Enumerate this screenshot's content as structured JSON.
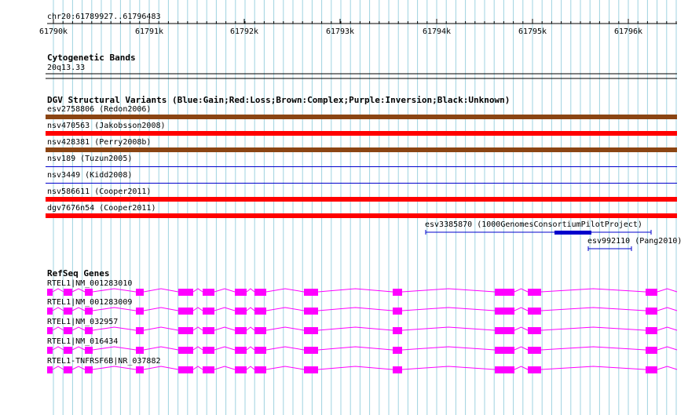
{
  "region_label": "chr20:61789927..61796483",
  "ruler": {
    "ticks": [
      "61790k",
      "61791k",
      "61792k",
      "61793k",
      "61794k",
      "61795k",
      "61796k"
    ]
  },
  "cytobands": {
    "title": "Cytogenetic Bands",
    "band_label": "20q13.33"
  },
  "dgv": {
    "title": "DGV Structural Variants (Blue:Gain;Red:Loss;Brown:Complex;Purple:Inversion;Black:Unknown)",
    "variants": [
      {
        "label": "esv2758806 (Redon2006)",
        "type": "complex"
      },
      {
        "label": "nsv470563 (Jakobsson2008)",
        "type": "loss"
      },
      {
        "label": "nsv428381 (Perry2008b)",
        "type": "complex"
      },
      {
        "label": "nsv189 (Tuzun2005)",
        "type": "gain"
      },
      {
        "label": "nsv3449 (Kidd2008)",
        "type": "gain"
      },
      {
        "label": "nsv586611 (Cooper2011)",
        "type": "loss"
      },
      {
        "label": "dgv7676n54 (Cooper2011)",
        "type": "loss"
      },
      {
        "label": "esv3385870 (1000GenomesConsortiumPilotProject)",
        "type": "gain"
      },
      {
        "label": "esv992110 (Pang2010)",
        "type": "gain"
      }
    ]
  },
  "refseq": {
    "title": "RefSeq Genes",
    "genes": [
      {
        "label": "RTEL1|NM_001283010"
      },
      {
        "label": "RTEL1|NM_001283009"
      },
      {
        "label": "RTEL1|NM_032957"
      },
      {
        "label": "RTEL1|NM_016434"
      },
      {
        "label": "RTEL1-TNFRSF6B|NR_037882"
      }
    ]
  },
  "colors": {
    "gridline": "#9fd3e0",
    "complex": "#8b4513",
    "loss": "#ff0000",
    "gain": "#0000cc",
    "gene": "#ff00ff",
    "axis": "#000000"
  }
}
